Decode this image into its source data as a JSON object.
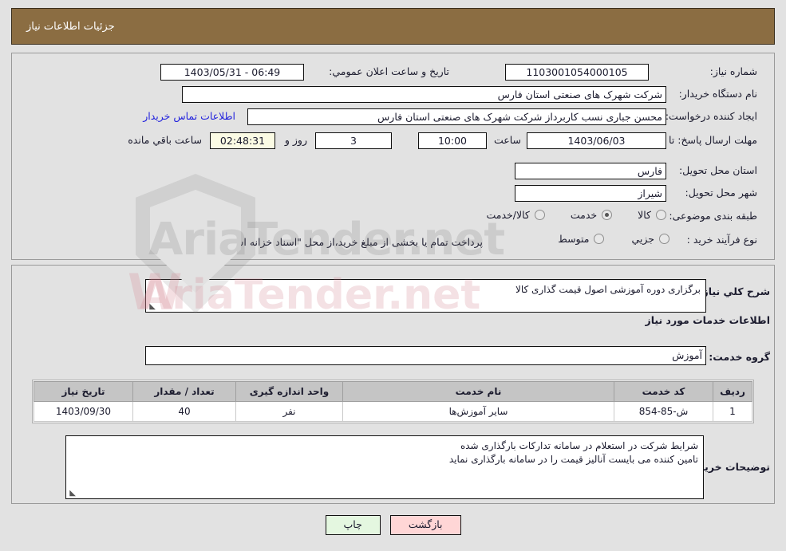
{
  "header": {
    "title": "جزئیات اطلاعات نیاز"
  },
  "colors": {
    "header_bar": "#8b6d42",
    "page_bg": "#e2e2e2",
    "link": "#2222dd",
    "countdown_bg": "#fbfbe4",
    "back_button": "#ffd6d6",
    "print_button": "#e4f7e0",
    "table_header": "#c5c5c5"
  },
  "form": {
    "need_number": {
      "label": "شماره نیاز:",
      "value": "1103001054000105"
    },
    "public_announce": {
      "label": "تاریخ و ساعت اعلان عمومي:",
      "value": "1403/05/31 - 06:49"
    },
    "buyer_org": {
      "label": "نام دستگاه خریدار:",
      "value": "شرکت شهرک های صنعتی استان فارس"
    },
    "requester": {
      "label": "ایجاد کننده درخواست:",
      "value": "محسن  جباری نسب کاربرداز شرکت شهرک های صنعتی استان فارس"
    },
    "contact_link": {
      "label": "اطلاعات تماس خریدار"
    },
    "deadline": {
      "label": "مهلت ارسال پاسخ: تا تاریخ:",
      "date": "1403/06/03",
      "time_label": "ساعت",
      "time": "10:00",
      "days": "3",
      "days_label": "روز و",
      "countdown": "02:48:31",
      "remaining_label": "ساعت باقي مانده"
    },
    "province": {
      "label": "استان محل تحویل:",
      "value": "فارس"
    },
    "city": {
      "label": "شهر محل تحویل:",
      "value": "شیراز"
    },
    "category": {
      "label": "طبقه بندی موضوعی:",
      "options": [
        "کالا",
        "خدمت",
        "کالا/خدمت"
      ],
      "selected": "خدمت"
    },
    "purchase_type": {
      "label": "نوع فرآیند خرید :",
      "options": [
        "جزیي",
        "متوسط"
      ],
      "selected": "",
      "note": "پرداخت تمام یا بخشی از مبلغ خرید،از محل \"اسناد خزانه اسلامی\" خواهد بود."
    }
  },
  "details": {
    "general_desc": {
      "label": "شرح کلي نیاز:",
      "value": "برگزاری دوره آموزشی اصول قیمت گذاری کالا"
    },
    "section_title": "اطلاعات خدمات مورد نیاز",
    "service_group": {
      "label": "گروه خدمت:",
      "value": "آموزش"
    },
    "buyer_notes": {
      "label": "توضیحات خریدار:",
      "line1": "شرایط شرکت در استعلام در سامانه تدارکات بارگذاری شده",
      "line2": "تامین کننده می بایست آنالیز قیمت را در سامانه بارگذاری نماید"
    }
  },
  "table": {
    "columns": [
      "ردیف",
      "کد خدمت",
      "نام خدمت",
      "واحد اندازه گیری",
      "تعداد / مقدار",
      "تاریخ نیاز"
    ],
    "rows": [
      {
        "index": "1",
        "code": "ش-85-854",
        "name": "سایر آموزش‌ها",
        "unit": "نفر",
        "quantity": "40",
        "need_date": "1403/09/30"
      }
    ]
  },
  "buttons": {
    "back": "بازگشت",
    "print": "چاپ"
  }
}
